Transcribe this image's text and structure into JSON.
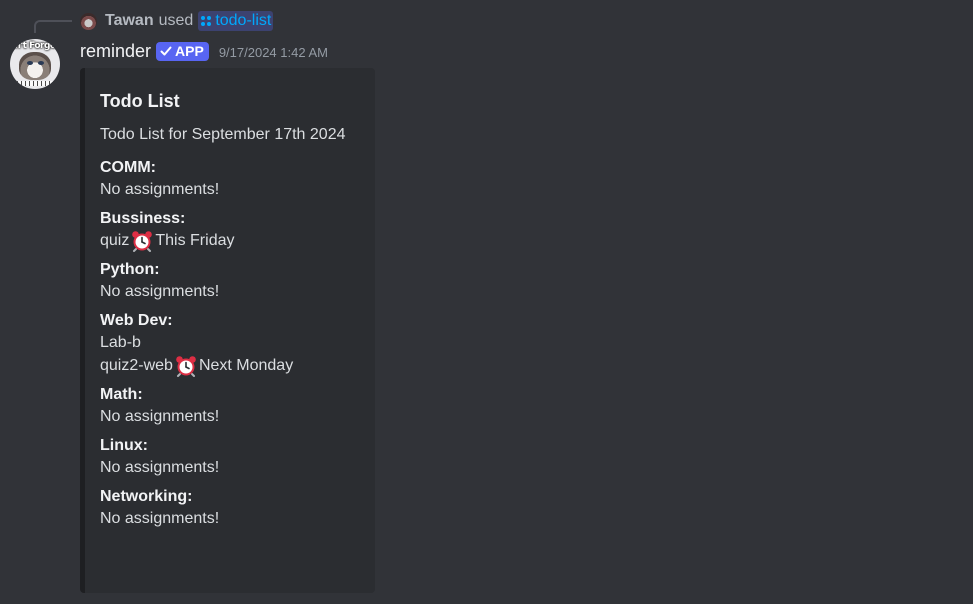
{
  "reply": {
    "user": "Tawan",
    "used_text": "used",
    "command": "todo-list"
  },
  "message": {
    "username": "reminder",
    "app_badge": "APP",
    "timestamp": "9/17/2024 1:42 AM",
    "avatar_caption": "n't Forge"
  },
  "embed": {
    "title": "Todo List",
    "description": "Todo List for September 17th 2024",
    "fields": [
      {
        "name": "COMM:",
        "lines": [
          {
            "text": "No assignments!"
          }
        ]
      },
      {
        "name": "Bussiness:",
        "lines": [
          {
            "before": "quiz",
            "icon": "alarm-clock-icon",
            "after": "This Friday"
          }
        ]
      },
      {
        "name": "Python:",
        "lines": [
          {
            "text": "No assignments!"
          }
        ]
      },
      {
        "name": "Web Dev:",
        "lines": [
          {
            "text": "Lab-b"
          },
          {
            "before": "quiz2-web",
            "icon": "alarm-clock-icon",
            "after": "Next Monday"
          }
        ]
      },
      {
        "name": "Math:",
        "lines": [
          {
            "text": "No assignments!"
          }
        ]
      },
      {
        "name": "Linux:",
        "lines": [
          {
            "text": "No assignments!"
          }
        ]
      },
      {
        "name": "Networking:",
        "lines": [
          {
            "text": "No assignments!"
          }
        ]
      }
    ]
  },
  "colors": {
    "background": "#313338",
    "embed_background": "#2b2d31",
    "app_badge": "#5865f2",
    "command_link": "#00a8fc"
  }
}
